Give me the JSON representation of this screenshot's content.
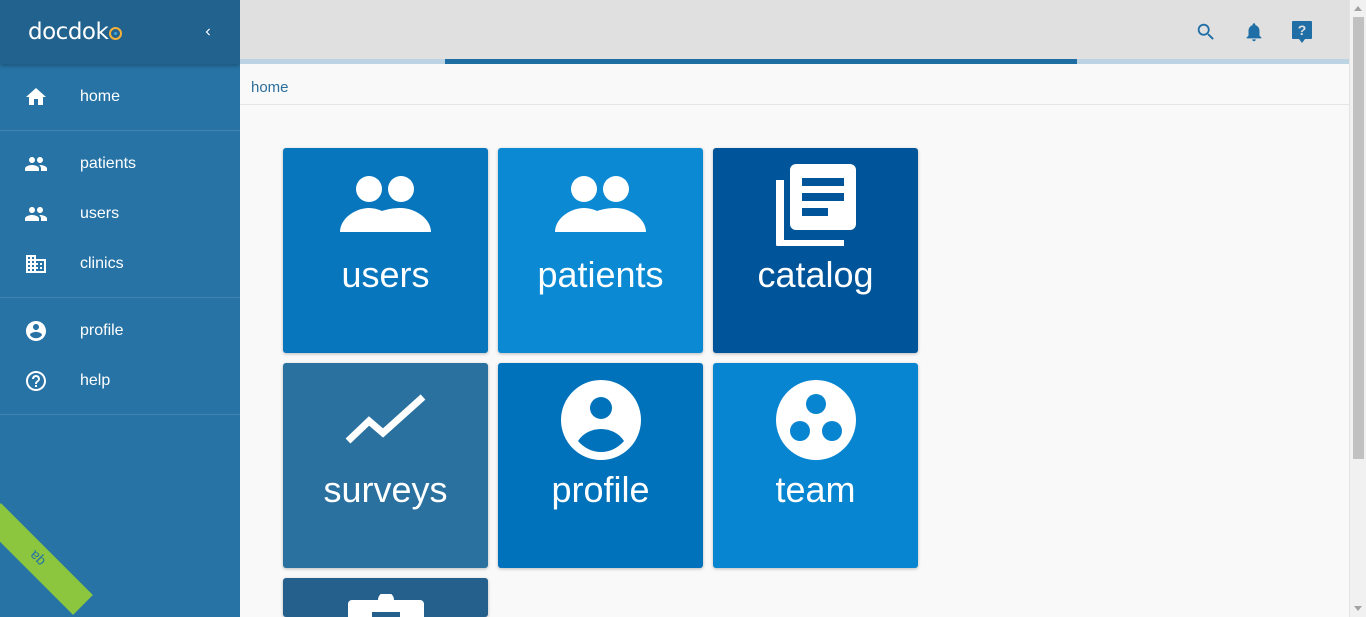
{
  "app": {
    "logo_text": "docdok"
  },
  "sidebar": {
    "collapse_icon": "chevron-left-icon",
    "groups": [
      [
        {
          "label": "home",
          "icon": "home-icon"
        }
      ],
      [
        {
          "label": "patients",
          "icon": "people-icon"
        },
        {
          "label": "users",
          "icon": "people-icon"
        },
        {
          "label": "clinics",
          "icon": "building-icon"
        }
      ],
      [
        {
          "label": "profile",
          "icon": "account-circle-icon"
        },
        {
          "label": "help",
          "icon": "help-circle-icon"
        }
      ]
    ],
    "env_ribbon": "qa"
  },
  "topbar": {
    "actions": [
      "search-icon",
      "bell-icon",
      "help-bubble-icon"
    ],
    "progress": 0.569
  },
  "breadcrumb": {
    "current": "home"
  },
  "tiles": [
    {
      "label": "users",
      "icon": "people-icon",
      "color": "#0776bd"
    },
    {
      "label": "patients",
      "icon": "people-icon",
      "color": "#0b89d3"
    },
    {
      "label": "catalog",
      "icon": "library-books-icon",
      "color": "#00559a"
    },
    {
      "label": "surveys",
      "icon": "trend-line-icon",
      "color": "#2a719f"
    },
    {
      "label": "profile",
      "icon": "account-circle-icon",
      "color": "#0072bb"
    },
    {
      "label": "team",
      "icon": "group-work-icon",
      "color": "#0885d0"
    },
    {
      "label": "",
      "icon": "clipboard-icon",
      "color": "#255f8c"
    }
  ]
}
